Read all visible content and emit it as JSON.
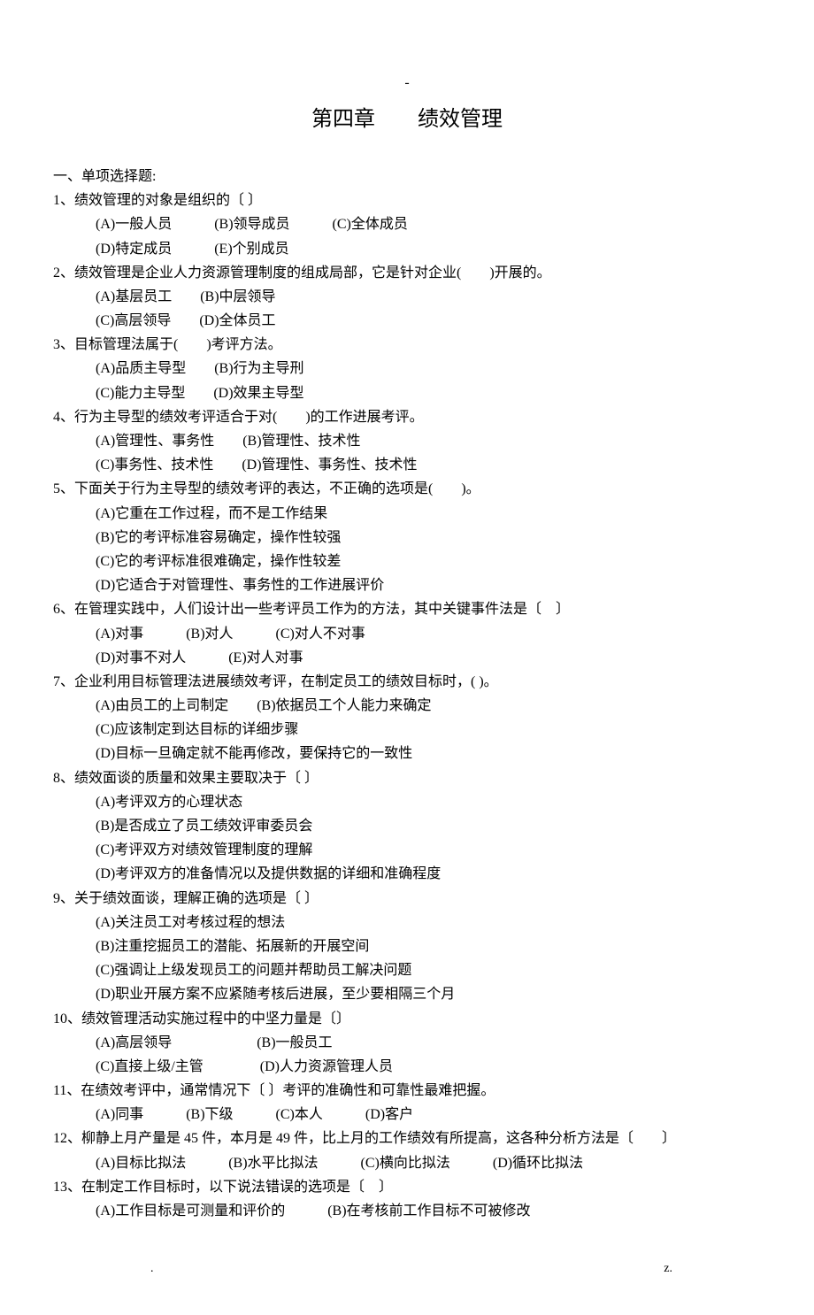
{
  "top_mark": "-",
  "title": "第四章　　绩效管理",
  "section_heading": "一、单项选择题:",
  "questions": [
    {
      "stem": "1、绩效管理的对象是组织的〔  〕",
      "option_lines": [
        "(A)一般人员　　　(B)领导成员　　　(C)全体成员",
        "(D)特定成员　　　(E)个别成员"
      ]
    },
    {
      "stem": "2、绩效管理是企业人力资源管理制度的组成局部，它是针对企业(　　)开展的。",
      "option_lines": [
        "(A)基层员工　　(B)中层领导",
        "(C)高层领导　　(D)全体员工"
      ]
    },
    {
      "stem": "3、目标管理法属于(　　)考评方法。",
      "option_lines": [
        "(A)品质主导型　　(B)行为主导刑",
        "(C)能力主导型　　(D)效果主导型"
      ]
    },
    {
      "stem": "4、行为主导型的绩效考评适合于对(　　)的工作进展考评。",
      "option_lines": [
        "(A)管理性、事务性　　(B)管理性、技术性",
        "(C)事务性、技术性　　(D)管理性、事务性、技术性"
      ]
    },
    {
      "stem": "5、下面关于行为主导型的绩效考评的表达，不正确的选项是(　　)。",
      "option_lines": [
        "(A)它重在工作过程，而不是工作结果",
        "(B)它的考评标准容易确定，操作性较强",
        "(C)它的考评标准很难确定，操作性较差",
        "(D)它适合于对管理性、事务性的工作进展评价"
      ]
    },
    {
      "stem": "6、在管理实践中，人们设计出一些考评员工作为的方法，其中关键事件法是〔　〕",
      "option_lines": [
        "(A)对事　　　(B)对人　　　(C)对人不对事",
        "(D)对事不对人　　　(E)对人对事"
      ]
    },
    {
      "stem": "7、企业利用目标管理法进展绩效考评，在制定员工的绩效目标时，( )。",
      "option_lines": [
        "(A)由员工的上司制定　　(B)依据员工个人能力来确定",
        "(C)应该制定到达目标的详细步骤",
        "(D)目标一旦确定就不能再修改，要保持它的一致性"
      ]
    },
    {
      "stem": "8、绩效面谈的质量和效果主要取决于〔  〕",
      "option_lines": [
        "(A)考评双方的心理状态",
        "(B)是否成立了员工绩效评审委员会",
        "(C)考评双方对绩效管理制度的理解",
        "(D)考评双方的准备情况以及提供数据的详细和准确程度"
      ]
    },
    {
      "stem": "9、关于绩效面谈，理解正确的选项是〔  〕",
      "option_lines": [
        "(A)关注员工对考核过程的想法",
        "(B)注重挖掘员工的潜能、拓展新的开展空间",
        "(C)强调让上级发现员工的问题并帮助员工解决问题",
        "(D)职业开展方案不应紧随考核后进展，至少要相隔三个月"
      ]
    },
    {
      "stem": "10、绩效管理活动实施过程中的中坚力量是〔〕",
      "option_lines": [
        "(A)高层领导　　　　　　(B)一般员工",
        "(C)直接上级/主管　　　　(D)人力资源管理人员"
      ]
    },
    {
      "stem": "11、在绩效考评中，通常情况下〔  〕考评的准确性和可靠性最难把握。",
      "option_lines": [
        "(A)同事　　　(B)下级　　　(C)本人　　　(D)客户"
      ]
    },
    {
      "stem": "12、柳静上月产量是 45 件，本月是 49 件，比上月的工作绩效有所提高，这各种分析方法是〔　　〕",
      "option_lines": [
        "(A)目标比拟法　　　(B)水平比拟法　　　(C)横向比拟法　　　(D)循环比拟法"
      ]
    },
    {
      "stem": "13、在制定工作目标时，以下说法错误的选项是〔　〕",
      "option_lines": [
        "(A)工作目标是可测量和评价的　　　(B)在考核前工作目标不可被修改"
      ]
    }
  ],
  "footer_left": ".",
  "footer_right": "z."
}
